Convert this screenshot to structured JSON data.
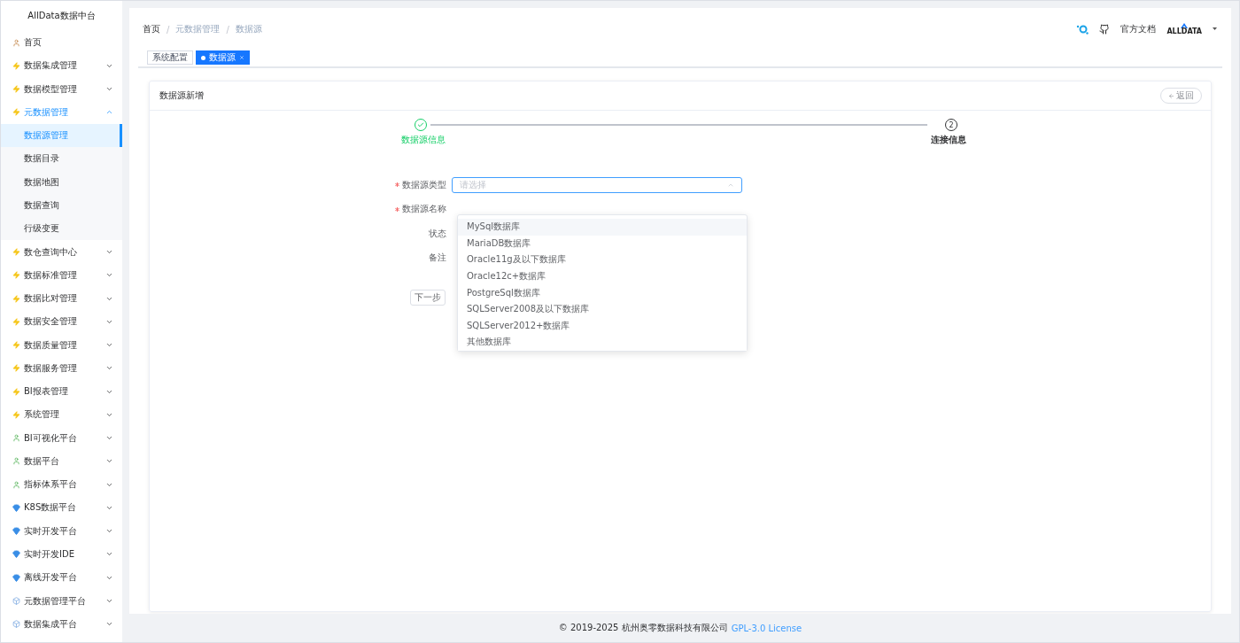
{
  "sidebar": {
    "title": "AllData数据中台",
    "items": [
      {
        "label": "首页",
        "kind": "home",
        "selected": false
      },
      {
        "label": "数据集成管理",
        "kind": "bolt",
        "expanded": false,
        "selected": false
      },
      {
        "label": "数据模型管理",
        "kind": "bolt",
        "expanded": false,
        "selected": false
      },
      {
        "label": "元数据管理",
        "kind": "bolt",
        "expanded": true,
        "selected": true,
        "children": [
          {
            "label": "数据源管理",
            "selected": true
          },
          {
            "label": "数据目录",
            "selected": false
          },
          {
            "label": "数据地图",
            "selected": false
          },
          {
            "label": "数据查询",
            "selected": false
          },
          {
            "label": "行级变更",
            "selected": false
          }
        ]
      },
      {
        "label": "数仓查询中心",
        "kind": "bolt",
        "expanded": false,
        "selected": false
      },
      {
        "label": "数据标准管理",
        "kind": "bolt",
        "expanded": false,
        "selected": false
      },
      {
        "label": "数据比对管理",
        "kind": "bolt",
        "expanded": false,
        "selected": false
      },
      {
        "label": "数据安全管理",
        "kind": "bolt",
        "expanded": false,
        "selected": false
      },
      {
        "label": "数据质量管理",
        "kind": "bolt",
        "expanded": false,
        "selected": false
      },
      {
        "label": "数据服务管理",
        "kind": "bolt",
        "expanded": false,
        "selected": false
      },
      {
        "label": "BI报表管理",
        "kind": "bolt",
        "expanded": false,
        "selected": false
      },
      {
        "label": "系统管理",
        "kind": "bolt",
        "expanded": false,
        "selected": false
      },
      {
        "label": "BI可视化平台",
        "kind": "figure",
        "expanded": false,
        "selected": false
      },
      {
        "label": "数据平台",
        "kind": "figure",
        "expanded": false,
        "selected": false
      },
      {
        "label": "指标体系平台",
        "kind": "figure",
        "expanded": false,
        "selected": false
      },
      {
        "label": "K8S数据平台",
        "kind": "gem",
        "expanded": false,
        "selected": false
      },
      {
        "label": "实时开发平台",
        "kind": "gem",
        "expanded": false,
        "selected": false
      },
      {
        "label": "实时开发IDE",
        "kind": "gem",
        "expanded": false,
        "selected": false
      },
      {
        "label": "离线开发平台",
        "kind": "gem",
        "expanded": false,
        "selected": false
      },
      {
        "label": "元数据管理平台",
        "kind": "cube",
        "expanded": false,
        "selected": false
      },
      {
        "label": "数据集成平台",
        "kind": "cube",
        "expanded": false,
        "selected": false
      }
    ]
  },
  "header": {
    "breadcrumb": [
      {
        "label": "首页"
      },
      {
        "separator": "/",
        "label": "元数据管理"
      },
      {
        "separator": "/",
        "label": "数据源"
      }
    ],
    "docs_link": "官方文档",
    "logo_text": "ALLDATA"
  },
  "tags": [
    {
      "label": "系统配置",
      "selected": false
    },
    {
      "label": "数据源",
      "selected": true
    }
  ],
  "card": {
    "title": "数据源新增",
    "back_button": "返回",
    "steps": [
      {
        "label": "数据源信息",
        "done": true
      },
      {
        "label": "连接信息",
        "number": "2",
        "done": false
      }
    ],
    "form": [
      {
        "label": "数据源类型",
        "required": true
      },
      {
        "label": "数据源名称",
        "required": true
      },
      {
        "label": "状态",
        "required": false
      },
      {
        "label": "备注",
        "required": false
      }
    ],
    "select": {
      "placeholder": "请选择",
      "open": true
    },
    "options": [
      {
        "label": "MySql数据库",
        "highlighted": true
      },
      {
        "label": "MariaDB数据库",
        "highlighted": false
      },
      {
        "label": "Oracle11g及以下数据库",
        "highlighted": false
      },
      {
        "label": "Oracle12c+数据库",
        "highlighted": false
      },
      {
        "label": "PostgreSql数据库",
        "highlighted": false
      },
      {
        "label": "SQLServer2008及以下数据库",
        "highlighted": false
      },
      {
        "label": "SQLServer2012+数据库",
        "highlighted": false
      },
      {
        "label": "其他数据库",
        "highlighted": false
      }
    ],
    "next_button": "下一步"
  },
  "footer": {
    "copyright": "© 2019-2025 杭州奥零数据科技有限公司",
    "license_link": "GPL-3.0 License"
  }
}
